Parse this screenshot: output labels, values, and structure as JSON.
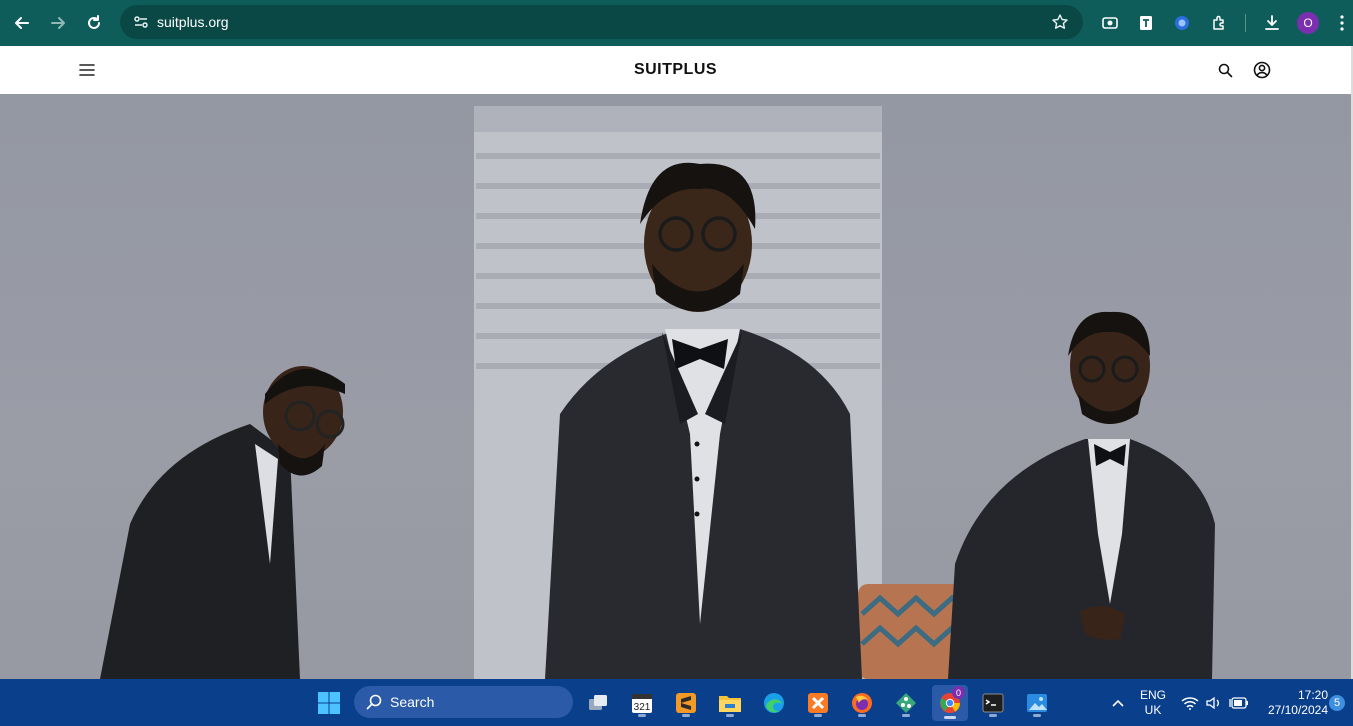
{
  "browser": {
    "url": "suitplus.org",
    "profile_initial": "O"
  },
  "site": {
    "brand": "SUITPLUS"
  },
  "hero": {
    "image_alt": "Three men in black tuxedos with bow ties posing against a white wall"
  },
  "taskbar": {
    "search_label": "Search",
    "chrome_badge": "0",
    "language_line1": "ENG",
    "language_line2": "UK",
    "time": "17:20",
    "date": "27/10/2024",
    "notification_count": "5"
  },
  "colors": {
    "chrome": "#0f5d5b",
    "omnibox": "#0a4846",
    "taskbar": "#0a3f8c",
    "profile": "#7b2fb0"
  }
}
